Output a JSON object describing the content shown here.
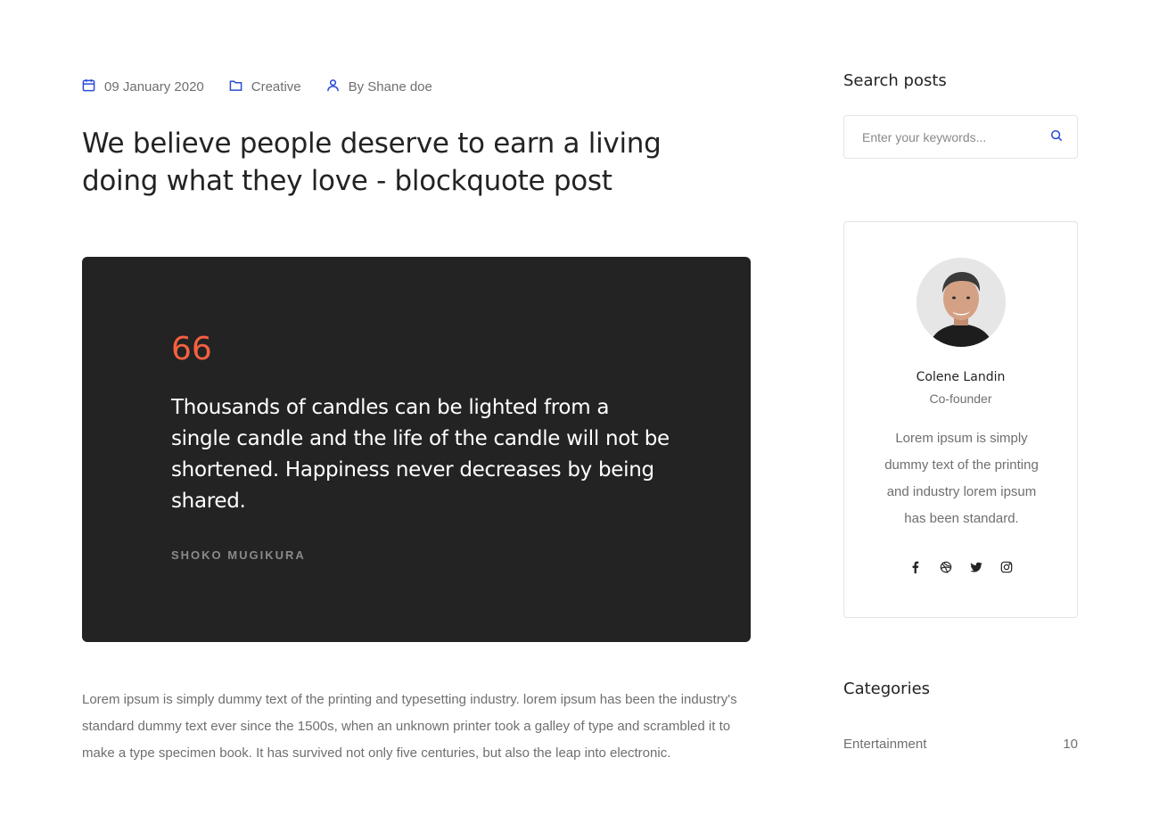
{
  "post": {
    "date": "09 January 2020",
    "category": "Creative",
    "author": "By Shane doe",
    "title": "We believe people deserve to earn a living doing what they love - blockquote post",
    "quote": {
      "mark": "66",
      "text": "Thousands of candles can be lighted from a single candle and the life of the candle will not be shortened. Happiness never decreases by being shared.",
      "author": "SHOKO MUGIKURA"
    },
    "body": "Lorem ipsum is simply dummy text of the printing and typesetting industry. lorem ipsum has been the industry's standard dummy text ever since the 1500s, when an unknown printer took a galley of type and scrambled it to make a type specimen book. It has survived not only five centuries, but also the leap into electronic."
  },
  "sidebar": {
    "search": {
      "heading": "Search posts",
      "placeholder": "Enter your keywords...",
      "icon": "search-icon"
    },
    "profile": {
      "name": "Colene Landin",
      "role": "Co-founder",
      "bio": "Lorem ipsum is simply dummy text of the printing and industry lorem ipsum has been standard.",
      "social": [
        "facebook-icon",
        "dribbble-icon",
        "twitter-icon",
        "instagram-icon"
      ]
    },
    "categories": {
      "heading": "Categories",
      "items": [
        {
          "label": "Entertainment",
          "count": "10"
        }
      ]
    }
  },
  "colors": {
    "accent": "#2a4bd8",
    "quote_mark": "#f56040",
    "quote_bg": "#232323",
    "text_muted": "#6f6f6f"
  }
}
